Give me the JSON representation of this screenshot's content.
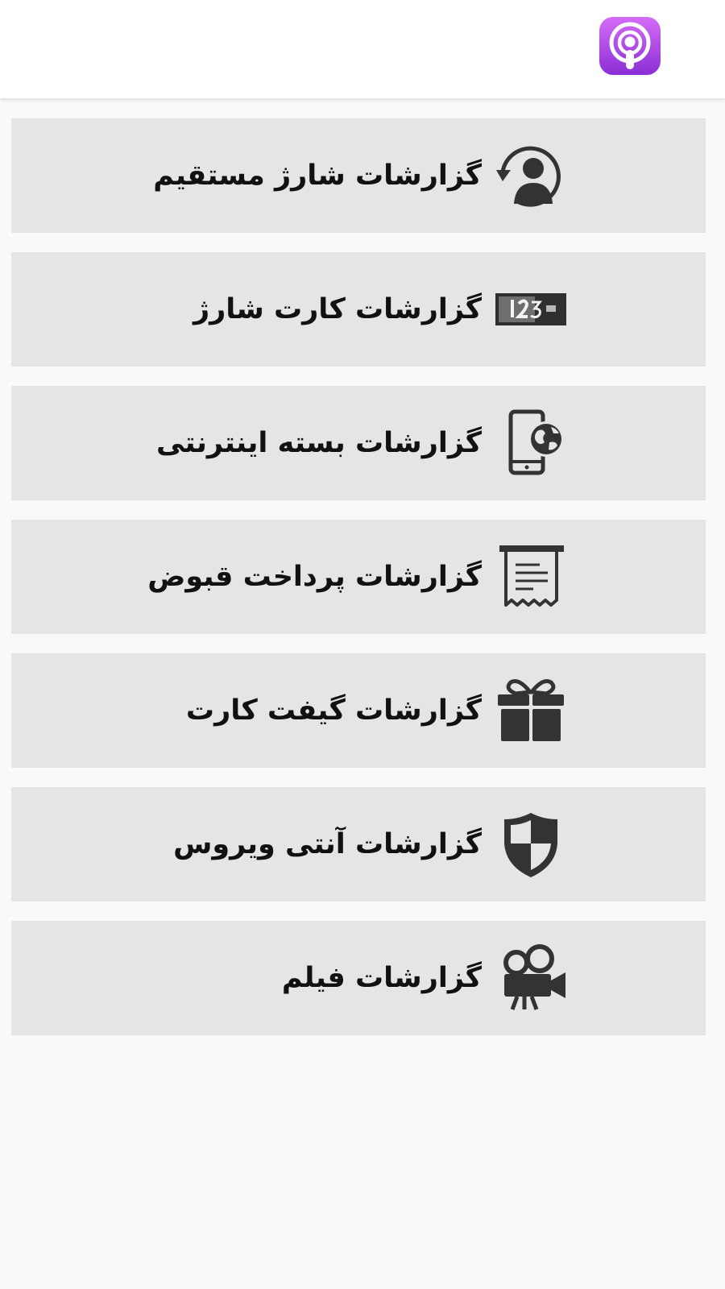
{
  "header": {
    "logo_icon": "podcast-icon",
    "logo_gradient": [
      "#d56cf7",
      "#8a2fd6"
    ]
  },
  "colors": {
    "item_background": "#e5e5e5",
    "icon_color": "#333333",
    "text_color": "#111111",
    "page_background": "#f9f9f9"
  },
  "menu": {
    "items": [
      {
        "label": "گزارشات شارژ مستقیم",
        "icon": "user-refresh-icon"
      },
      {
        "label": "گزارشات کارت شارژ",
        "icon": "charge-card-icon"
      },
      {
        "label": "گزارشات بسته اینترنتی",
        "icon": "mobile-globe-icon"
      },
      {
        "label": "گزارشات پرداخت قبوض",
        "icon": "receipt-icon"
      },
      {
        "label": "گزارشات گیفت کارت",
        "icon": "gift-icon"
      },
      {
        "label": "گزارشات آنتی ویروس",
        "icon": "shield-icon"
      },
      {
        "label": "گزارشات فیلم",
        "icon": "video-camera-icon"
      }
    ]
  }
}
